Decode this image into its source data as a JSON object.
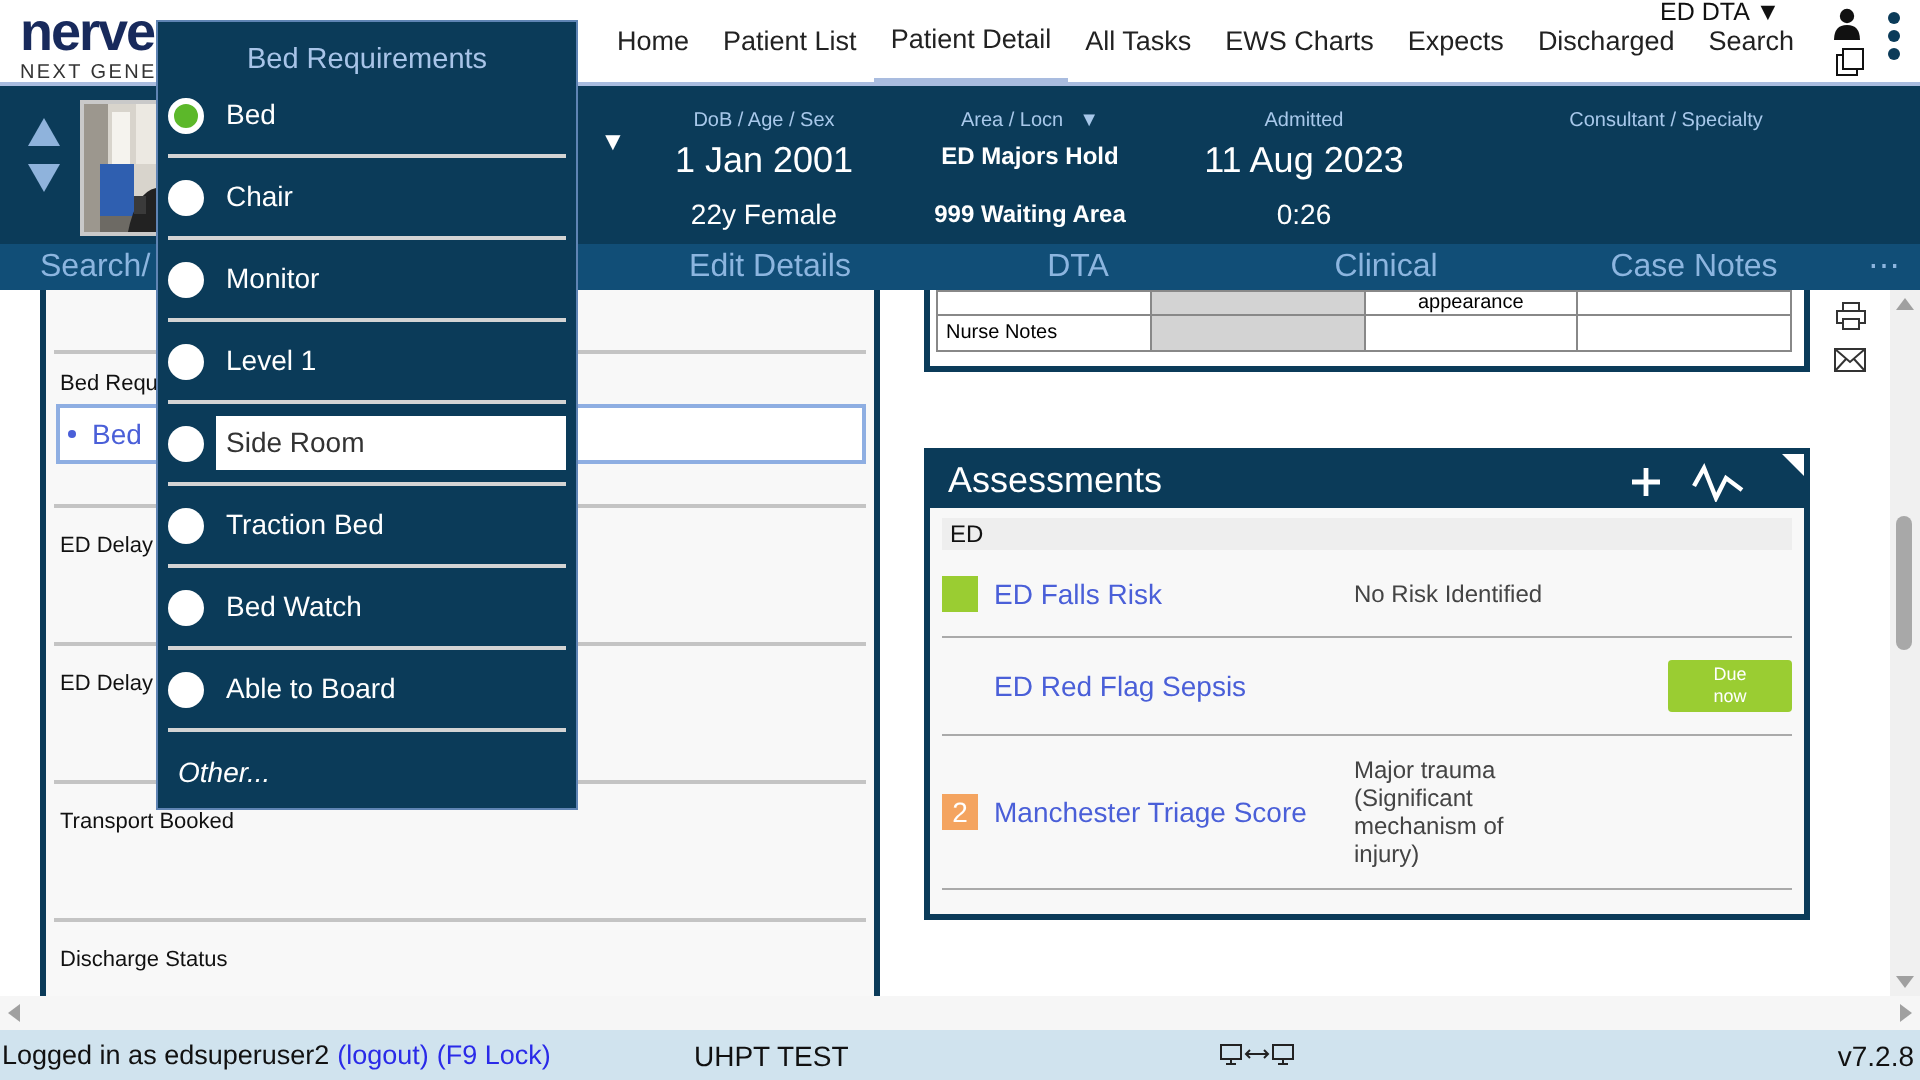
{
  "logo": {
    "word": "nerve",
    "tagline": "NEXT GENE"
  },
  "nav": {
    "items": [
      {
        "label": "Home",
        "selected": false
      },
      {
        "label": "Patient List",
        "selected": false
      },
      {
        "label": "Patient Detail",
        "selected": true
      },
      {
        "label": "All Tasks",
        "selected": false
      },
      {
        "label": "EWS Charts",
        "selected": false
      },
      {
        "label": "Expects",
        "selected": false
      },
      {
        "label": "Discharged",
        "selected": false
      },
      {
        "label": "Search",
        "selected": false
      }
    ],
    "ward": "ED DTA ▼"
  },
  "patient": {
    "name_caret": "▼",
    "fields": [
      {
        "kind": "date",
        "label": "DoB / Age / Sex",
        "value": "1 Jan 2001",
        "detail": "22y Female"
      },
      {
        "kind": "location",
        "label": "Area / Locn",
        "menu": "▼",
        "value": "ED Majors Hold",
        "detail": "999 Waiting Area"
      },
      {
        "kind": "date",
        "label": "Admitted",
        "value": "11 Aug 2023",
        "detail": "0:26"
      },
      {
        "kind": "date",
        "label": "Consultant / Specialty"
      }
    ]
  },
  "tabs": [
    "Search/",
    "Edit Details",
    "DTA",
    "Clinical",
    "Case Notes",
    "⋯"
  ],
  "form": {
    "fields": [
      {
        "label": "Bed Requ",
        "values": [
          "Bed"
        ],
        "focused": true
      },
      {
        "label": "ED Delay"
      },
      {
        "label": "ED Delay"
      },
      {
        "label": "Transport Booked"
      },
      {
        "label": "Discharge Status"
      }
    ]
  },
  "notes_table": {
    "rows": [
      {
        "column_3": "appearance"
      },
      {
        "column_1": "Nurse Notes"
      }
    ]
  },
  "assessments": {
    "title": "Assessments",
    "group": "ED",
    "rows": [
      {
        "name": "ED Falls Risk",
        "color": "#9acd32",
        "result": "No Risk Identified"
      },
      {
        "name": "ED Red Flag Sepsis",
        "status": "Due now"
      },
      {
        "name": "Manchester Triage Score",
        "color": "#f4a460",
        "badge_text": "2",
        "result": "Major trauma (Significant mechanism of injury)"
      }
    ]
  },
  "popup": {
    "title": "Bed Requirements",
    "options": [
      {
        "label": "Bed",
        "selected": true,
        "highlighted": false
      },
      {
        "label": "Chair",
        "selected": false,
        "highlighted": false
      },
      {
        "label": "Monitor",
        "selected": false,
        "highlighted": false
      },
      {
        "label": "Level 1",
        "selected": false,
        "highlighted": false
      },
      {
        "label": "Side Room",
        "selected": false,
        "highlighted": true
      },
      {
        "label": "Traction Bed",
        "selected": false,
        "highlighted": false
      },
      {
        "label": "Bed Watch",
        "selected": false,
        "highlighted": false
      },
      {
        "label": "Able to Board",
        "selected": false,
        "highlighted": false
      }
    ],
    "other": "Other..."
  },
  "status_bar": {
    "user_text": "Logged in as edsuperuser2",
    "logout": "(logout)",
    "lock": "(F9 Lock)",
    "environment": "UHPT TEST",
    "version": "v7.2.8"
  }
}
